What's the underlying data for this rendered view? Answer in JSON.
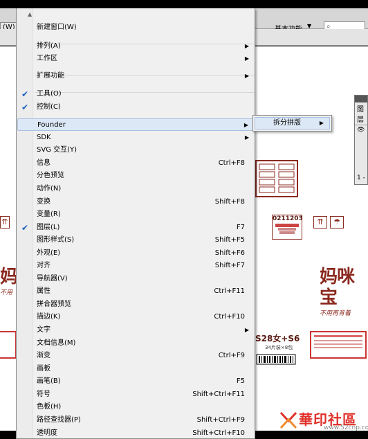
{
  "app": {
    "window_menu_button": "(W)",
    "workspace_label": "基本功能",
    "workspace_dropdown_arrow": "▼",
    "search_icon_glyph": "⌕",
    "control_bar_left": "基本",
    "control_bar_field": "基",
    "panel_tab": "图层",
    "panel_footer": "1 -"
  },
  "menu": {
    "items": [
      {
        "label": "新建窗口(W)",
        "shortcut": "",
        "submenu": false,
        "checked": false
      },
      {
        "label": "排列(A)",
        "shortcut": "",
        "submenu": true,
        "checked": false
      },
      {
        "label": "工作区",
        "shortcut": "",
        "submenu": true,
        "checked": false
      },
      {
        "label": "扩展功能",
        "shortcut": "",
        "submenu": true,
        "checked": false
      },
      {
        "label": "工具(O)",
        "shortcut": "",
        "submenu": false,
        "checked": true
      },
      {
        "label": "控制(C)",
        "shortcut": "",
        "submenu": false,
        "checked": true
      },
      {
        "label": "Founder",
        "shortcut": "",
        "submenu": true,
        "checked": false,
        "highlighted": true
      },
      {
        "label": "SDK",
        "shortcut": "",
        "submenu": true,
        "checked": false
      },
      {
        "label": "SVG 交互(Y)",
        "shortcut": "",
        "submenu": false,
        "checked": false
      },
      {
        "label": "信息",
        "shortcut": "Ctrl+F8",
        "submenu": false,
        "checked": false
      },
      {
        "label": "分色预览",
        "shortcut": "",
        "submenu": false,
        "checked": false
      },
      {
        "label": "动作(N)",
        "shortcut": "",
        "submenu": false,
        "checked": false
      },
      {
        "label": "变换",
        "shortcut": "Shift+F8",
        "submenu": false,
        "checked": false
      },
      {
        "label": "变量(R)",
        "shortcut": "",
        "submenu": false,
        "checked": false
      },
      {
        "label": "图层(L)",
        "shortcut": "F7",
        "submenu": false,
        "checked": true
      },
      {
        "label": "图形样式(S)",
        "shortcut": "Shift+F5",
        "submenu": false,
        "checked": false
      },
      {
        "label": "外观(E)",
        "shortcut": "Shift+F6",
        "submenu": false,
        "checked": false
      },
      {
        "label": "对齐",
        "shortcut": "Shift+F7",
        "submenu": false,
        "checked": false
      },
      {
        "label": "导航器(V)",
        "shortcut": "",
        "submenu": false,
        "checked": false
      },
      {
        "label": "属性",
        "shortcut": "Ctrl+F11",
        "submenu": false,
        "checked": false
      },
      {
        "label": "拼合器预览",
        "shortcut": "",
        "submenu": false,
        "checked": false
      },
      {
        "label": "描边(K)",
        "shortcut": "Ctrl+F10",
        "submenu": false,
        "checked": false
      },
      {
        "label": "文字",
        "shortcut": "",
        "submenu": true,
        "checked": false
      },
      {
        "label": "文档信息(M)",
        "shortcut": "",
        "submenu": false,
        "checked": false
      },
      {
        "label": "渐变",
        "shortcut": "Ctrl+F9",
        "submenu": false,
        "checked": false
      },
      {
        "label": "画板",
        "shortcut": "",
        "submenu": false,
        "checked": false
      },
      {
        "label": "画笔(B)",
        "shortcut": "F5",
        "submenu": false,
        "checked": false
      },
      {
        "label": "符号",
        "shortcut": "Shift+Ctrl+F11",
        "submenu": false,
        "checked": false
      },
      {
        "label": "色板(H)",
        "shortcut": "",
        "submenu": false,
        "checked": false
      },
      {
        "label": "路径查找器(P)",
        "shortcut": "Shift+Ctrl+F9",
        "submenu": false,
        "checked": false
      },
      {
        "label": "透明度",
        "shortcut": "Shift+Ctrl+F10",
        "submenu": false,
        "checked": false
      }
    ],
    "check_glyph": "✔",
    "submenu_arrow": "▶",
    "scroll_up_arrow": "▲"
  },
  "submenu": {
    "label": "拆分拼版"
  },
  "canvas": {
    "code_label": "0211203",
    "product_text": "S28女+S6",
    "product_sub": "34片装×8包",
    "brand_text": "妈咪宝",
    "brand_text_left": "妈",
    "brand_slogan": "不用再背着",
    "brand_slogan_left": "不用",
    "accent_color": "#8b2a20"
  },
  "watermark": {
    "text": "華印社區",
    "url": "www.52cnp.com"
  }
}
